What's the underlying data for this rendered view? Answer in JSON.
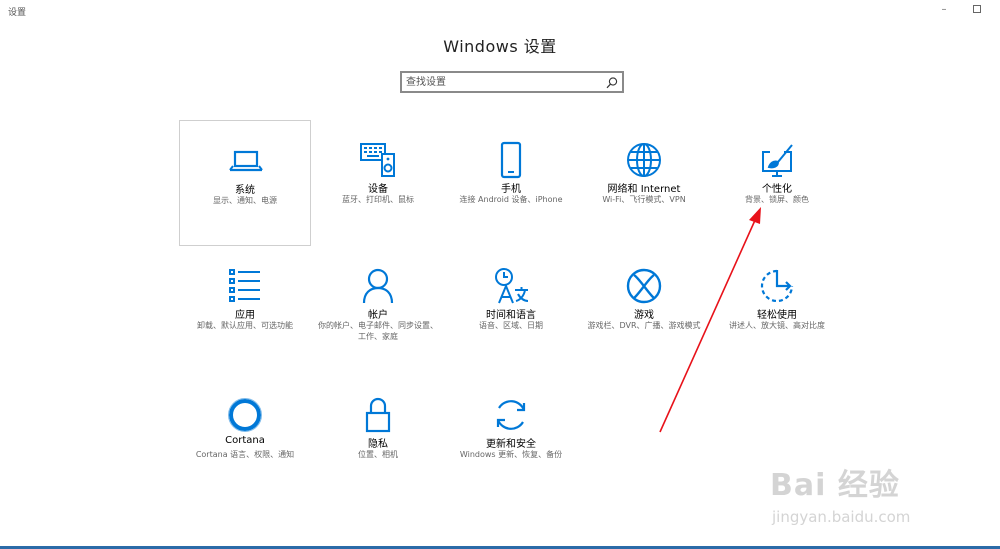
{
  "window": {
    "app_title": "设置",
    "minimize_glyph": "–"
  },
  "page": {
    "title": "Windows 设置"
  },
  "search": {
    "placeholder": "查找设置",
    "icon": "search-icon"
  },
  "tiles": [
    {
      "name": "系统",
      "desc": "显示、通知、电源",
      "icon": "laptop-icon",
      "selected": true
    },
    {
      "name": "设备",
      "desc": "蓝牙、打印机、鼠标",
      "icon": "devices-icon"
    },
    {
      "name": "手机",
      "desc": "连接 Android 设备、iPhone",
      "icon": "phone-icon"
    },
    {
      "name": "网络和 Internet",
      "desc": "Wi-Fi、飞行模式、VPN",
      "icon": "globe-icon"
    },
    {
      "name": "个性化",
      "desc": "背景、锁屏、颜色",
      "icon": "paint-icon"
    },
    {
      "name": "应用",
      "desc": "卸载、默认应用、可选功能",
      "icon": "apps-list-icon"
    },
    {
      "name": "帐户",
      "desc": "你的帐户、电子邮件、同步设置、工作、家庭",
      "icon": "person-icon"
    },
    {
      "name": "时间和语言",
      "desc": "语音、区域、日期",
      "icon": "time-language-icon"
    },
    {
      "name": "游戏",
      "desc": "游戏栏、DVR、广播、游戏模式",
      "icon": "xbox-icon"
    },
    {
      "name": "轻松使用",
      "desc": "讲述人、放大镜、高对比度",
      "icon": "ease-of-access-icon"
    },
    {
      "name": "Cortana",
      "desc": "Cortana 语言、权限、通知",
      "icon": "cortana-icon"
    },
    {
      "name": "隐私",
      "desc": "位置、相机",
      "icon": "lock-icon"
    },
    {
      "name": "更新和安全",
      "desc": "Windows 更新、恢复、备份",
      "icon": "sync-icon"
    }
  ],
  "accent_color": "#0078d7",
  "annotation": {
    "arrow_color": "#e8121a",
    "points_to": "个性化"
  },
  "watermark": {
    "logo": "Bai 经验",
    "url": "jingyan.baidu.com"
  }
}
